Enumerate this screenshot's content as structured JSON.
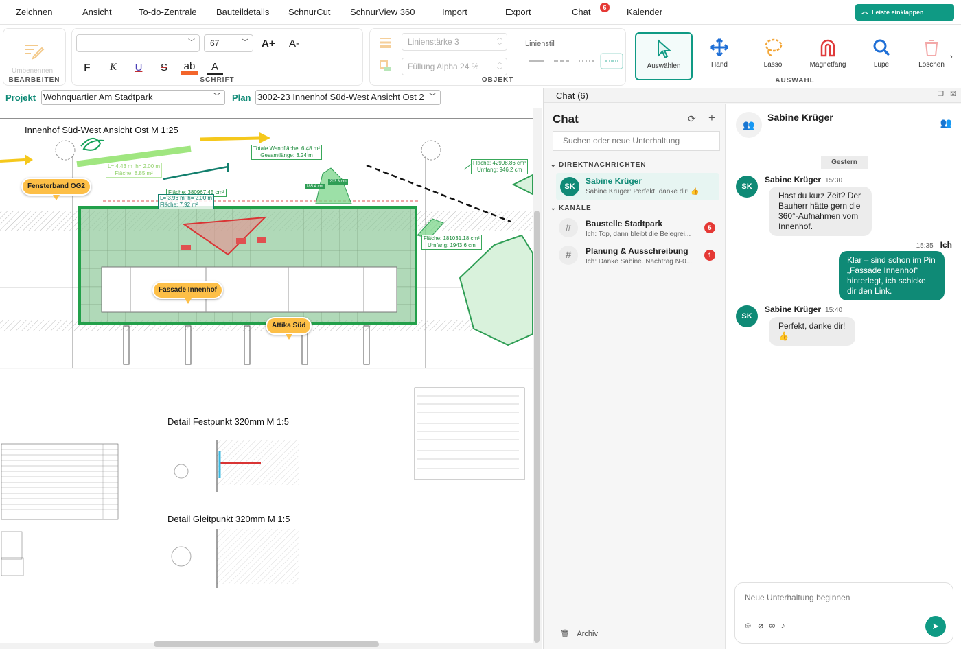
{
  "menu": {
    "items": [
      "Zeichnen",
      "Ansicht",
      "To-do-Zentrale",
      "Bauteildetails",
      "SchnurCut",
      "SchnurView 360",
      "Import",
      "Export",
      "Chat",
      "Kalender"
    ],
    "chat_badge": "6",
    "collapse_label": "Leiste einklappen"
  },
  "ribbon": {
    "bearbeiten": {
      "rename_label": "Umbenennen",
      "title": "BEARBEITEN"
    },
    "schrift": {
      "font_value": "",
      "size_value": "67",
      "grow": "A+",
      "shrink": "A-",
      "bold": "F",
      "italic": "K",
      "underline": "U",
      "strike": "S",
      "highlight": "ab",
      "color": "A",
      "title": "SCHRIFT"
    },
    "objekt": {
      "line_width_placeholder": "Linienstärke 3",
      "fill_placeholder": "Füllung Alpha 24 %",
      "line_style_label": "Linienstil",
      "title": "OBJEKT"
    },
    "auswahl": {
      "tools": [
        "Auswählen",
        "Hand",
        "Lasso",
        "Magnetfang",
        "Lupe",
        "Löschen"
      ],
      "title": "AUSWAHL"
    }
  },
  "project": {
    "label": "Projekt",
    "value": "Wohnquartier Am Stadtpark",
    "plan_label": "Plan",
    "plan_value": "3002-23 Innenhof Süd-West Ansicht Ost 2"
  },
  "drawing": {
    "title_main": "Innenhof Süd-West Ansicht Ost  M 1:25",
    "title_detail1": "Detail Festpunkt 320mm   M 1:5",
    "title_detail2": "Detail Gleitpunkt 320mm   M 1:5",
    "pins": [
      "Fensterband OG2",
      "Fassade Innenhof",
      "Attika Süd"
    ],
    "measures": {
      "wall": "Totale Wandfläche: 6.48 m²\nGesamtlänge: 3.24 m",
      "line1": "L= 4.43 m  h= 2.00 m\nFläche: 8.85 m²",
      "area1": "Fläche: 380967.45 cm²",
      "line2": "L= 3.96 m  h= 2.00 m\nFläche: 7.92 m²",
      "area2": "Fläche: 42908.86 cm²\nUmfang: 946.2 cm",
      "area3": "Fläche: 181031.18 cm²\nUmfang: 1943.6 cm",
      "dim1": "185.4 cm",
      "dim2": "203.3 cm"
    }
  },
  "chat": {
    "header_title": "Chat  (6)",
    "list_title": "Chat",
    "search_placeholder": "Suchen oder neue Unterhaltung",
    "dm_section": "DIREKTNACHRICHTEN",
    "channels_section": "KANÄLE",
    "direct": [
      {
        "initials": "SK",
        "name": "Sabine Krüger",
        "preview": "Sabine Krüger: Perfekt, danke dir! 👍"
      }
    ],
    "channels": [
      {
        "name": "Baustelle Stadtpark",
        "preview": "Ich: Top, dann bleibt die Belegrei...",
        "badge": "5"
      },
      {
        "name": "Planung & Ausschreibung",
        "preview": "Ich: Danke Sabine. Nachtrag N-0...",
        "badge": "1"
      }
    ],
    "archive_label": "Archiv",
    "conversation": {
      "name": "Sabine Krüger",
      "day_separator": "Gestern",
      "messages": [
        {
          "sender": "Sabine Krüger",
          "initials": "SK",
          "time": "15:30",
          "text": "Hast du kurz Zeit? Der Bauherr hätte gern die 360°-Aufnahmen vom Innenhof."
        },
        {
          "sender": "Ich",
          "time": "15:35",
          "text": "Klar – sind schon im Pin „Fassade Innenhof“ hinterlegt, ich schicke dir den Link."
        },
        {
          "sender": "Sabine Krüger",
          "initials": "SK",
          "time": "15:40",
          "text": "Perfekt, danke dir! 👍"
        }
      ],
      "composer_placeholder": "Neue Unterhaltung beginnen"
    }
  },
  "colors": {
    "accent": "#0f9a84",
    "badge": "#e53935",
    "pin": "#fdbf47",
    "markup_green": "#2f9e55",
    "markup_red": "#e05050"
  }
}
